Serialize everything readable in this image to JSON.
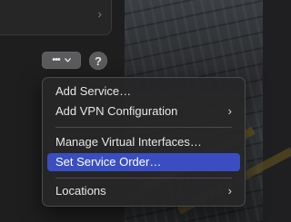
{
  "toolbar": {
    "action_glyph": "•••",
    "help_glyph": "?"
  },
  "previous_row": {
    "chevron": "›"
  },
  "menu": {
    "items": [
      {
        "label": "Add Service…",
        "submenu": false
      },
      {
        "label": "Add VPN Configuration",
        "submenu": true
      },
      {
        "label": "Manage Virtual Interfaces…",
        "submenu": false
      },
      {
        "label": "Set Service Order…",
        "submenu": false,
        "highlighted": true
      },
      {
        "label": "Locations",
        "submenu": true
      }
    ],
    "submenu_glyph": "›"
  },
  "colors": {
    "highlight": "#3a4ec2",
    "menu_background": "#262628",
    "button_background": "#5b5b5d"
  }
}
